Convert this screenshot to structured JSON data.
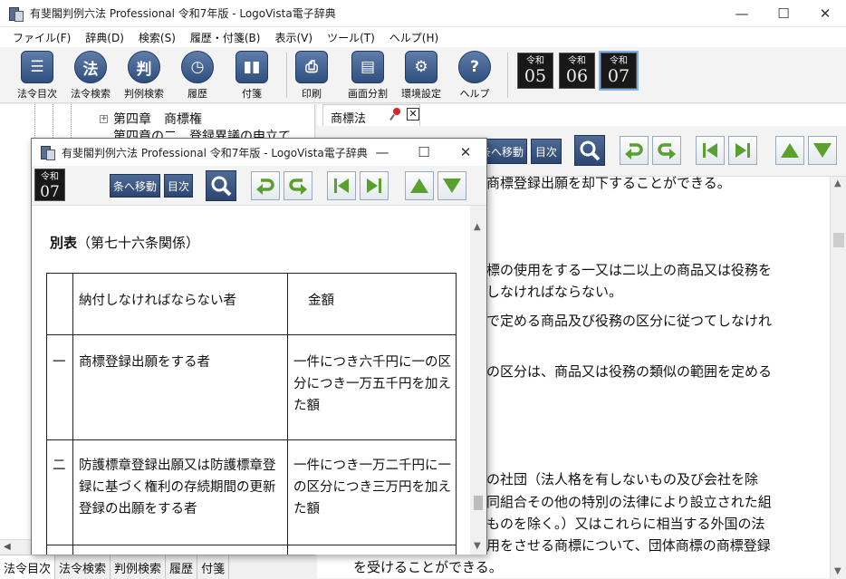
{
  "main_window": {
    "title": "有斐閣判例六法 Professional 令和7年版 - LogoVista電子辞典",
    "controls": {
      "minimize": "—",
      "maximize": "☐",
      "close": "✕"
    }
  },
  "menu": [
    "ファイル(F)",
    "辞典(D)",
    "検索(S)",
    "履歴・付箋(B)",
    "表示(V)",
    "ツール(T)",
    "ヘルプ(H)"
  ],
  "toolbar": {
    "buttons": [
      {
        "label": "法令目次",
        "glyph": "☰"
      },
      {
        "label": "法令検索",
        "glyph": "法"
      },
      {
        "label": "判例検索",
        "glyph": "判"
      },
      {
        "label": "履歴",
        "glyph": "◷"
      },
      {
        "label": "付箋",
        "glyph": "▮▮"
      },
      {
        "label": "印刷",
        "glyph": "⎙"
      },
      {
        "label": "画面分割",
        "glyph": "▤"
      },
      {
        "label": "環境設定",
        "glyph": "⚙"
      },
      {
        "label": "ヘルプ",
        "glyph": "?"
      }
    ],
    "era": [
      {
        "top": "令和",
        "num": "05"
      },
      {
        "top": "令和",
        "num": "06"
      },
      {
        "top": "令和",
        "num": "07"
      }
    ]
  },
  "tree": {
    "item_1": "第四章　商標権",
    "item_2": "第四章の二　登録異議の申立て"
  },
  "bottom_tabs": [
    "法令目次",
    "法令検索",
    "判例検索",
    "履歴",
    "付箋"
  ],
  "doc_tab": {
    "label": "商標法"
  },
  "right_toolbar": {
    "jump_label": "条へ移動",
    "toc_label": "目次"
  },
  "right_text": [
    "該商標登録出願を却下することができる。",
    "商標の使用をする一又は二以上の商品又は役務を",
    "こしなければならない。",
    "令で定める商品及び役務の区分に従つてしなけれ",
    "務の区分は、商品又は役務の類似の範囲を定める",
    "他の社団（法人格を有しないもの及び会社を除",
    "協同組合その他の特別の法律により設立された組",
    "いものを除く。）又はこれらに相当する外国の法",
    "使用をさせる商標について、団体商標の商標登録",
    "を受けることができる。"
  ],
  "popup": {
    "title": "有斐閣判例六法 Professional 令和7年版 - LogoVista電子辞典",
    "era": {
      "top": "令和",
      "num": "07"
    },
    "jump_label": "条へ移動",
    "toc_label": "目次",
    "heading_bold": "別表",
    "heading_rest": "（第七十六条関係）",
    "table": {
      "header": {
        "no": "",
        "who": "納付しなければならない者",
        "amt": "金額"
      },
      "rows": [
        {
          "no": "一",
          "who": "商標登録出願をする者",
          "amt": "一件につき六千円に一の区分につき一万五千円を加えた額"
        },
        {
          "no": "二",
          "who": "防護標章登録出願又は防護標章登録に基づく権利の存続期間の更新登録の出願をする者",
          "amt": "一件につき一万二千円に一の区分につき三万円を加えた額"
        }
      ]
    }
  }
}
